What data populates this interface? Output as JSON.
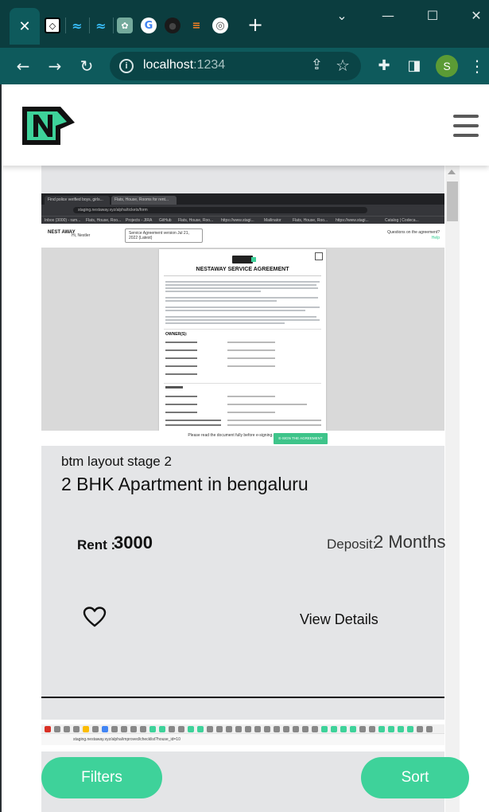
{
  "browser": {
    "active_tab_close": "✕",
    "new_tab": "+",
    "window_controls": {
      "minimize": "—",
      "maximize": "☐",
      "close": "✕",
      "tab_search": "⌄"
    },
    "url_host": "localhost",
    "url_port": ":1234",
    "profile_initial": "S",
    "icons": [
      "back-icon",
      "forward-icon",
      "reload-icon",
      "site-info-icon",
      "share-icon",
      "bookmark-star-icon",
      "extensions-icon",
      "side-panel-icon",
      "menu-icon"
    ]
  },
  "header": {
    "logo_letter": "N"
  },
  "listing": {
    "locality": "btm layout stage 2",
    "title": "2 BHK Apartment in bengaluru",
    "rent_label": "Rent :",
    "rent_value": "3000",
    "deposit_label": "Deposit:",
    "deposit_value": "2 Months",
    "view_details": "View Details",
    "image": {
      "tabs": [
        "Find police verified boys, girls...",
        "Flats, House, Rooms for rent..."
      ],
      "url": "staging.nestaway.xyz/alpha/tickets/form",
      "bookmarks": [
        "Inbox (3000) - ram...",
        "Flats, House, Roo...",
        "Projects - JIRA",
        "GitHub",
        "Flats, House, Roo...",
        "https://www.stagi...",
        "Mailinator",
        "Flats, House, Roo...",
        "https://www.stagi...",
        "Catalog | Codeca..."
      ],
      "brand_text": "NEST AWAY",
      "greeting": "Hi, Nestler",
      "select_label": "Service Agreement",
      "select_value": "version Jul 21, 2022 (Latest)",
      "question": "Questions on the agreement?",
      "help": "Help",
      "doc_title": "NESTAWAY SERVICE AGREEMENT",
      "owners_heading": "OWNER(S):",
      "footer_text": "Please read the document fully before e-signing.",
      "sign_button": "E-SIGN THE AGREEMENT"
    }
  },
  "next_listing": {
    "url": "staging.nestaway.xyz/alpha/improved/checklist?house_id=10"
  },
  "actions": {
    "filters": "Filters",
    "sort": "Sort"
  },
  "colors": {
    "brand_green": "#3ed29a",
    "chrome_dark": "#0b3d3f",
    "chrome_toolbar": "#0e5a5c",
    "card_bg": "#e4e5e7"
  }
}
